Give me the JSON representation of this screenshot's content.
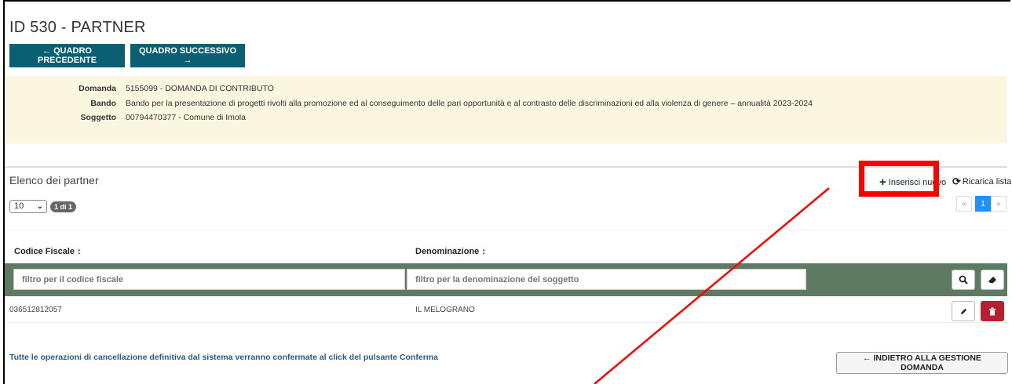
{
  "page": {
    "title": "ID 530 - PARTNER",
    "prev_label": "← QUADRO PRECEDENTE",
    "next_label": "QUADRO SUCCESSIVO →"
  },
  "info": {
    "rows": [
      {
        "label": "Domanda",
        "value": "5155099 - DOMANDA DI CONTRIBUTO"
      },
      {
        "label": "Bando",
        "value": "Bando per la presentazione di progetti rivolti alla promozione ed al conseguimento delle pari opportunità e al contrasto delle discriminazioni ed alla violenza di genere – annualità 2023-2024"
      },
      {
        "label": "Soggetto",
        "value": "00794470377 - Comune di Imola"
      }
    ]
  },
  "list": {
    "title": "Elenco dei partner",
    "page_size": "10",
    "page_badge": "1 di 1",
    "insert_label": "Inserisci nuovo",
    "reload_label": "Ricarica lista",
    "pager": [
      "«",
      "1",
      "»"
    ]
  },
  "table": {
    "columns": [
      "Codice Fiscale ↕",
      "Denominazione ↕"
    ],
    "filters": {
      "codice_placeholder": "filtro per il codice fiscale",
      "denominazione_placeholder": "filtro per la denominazione del soggetto"
    },
    "rows": [
      {
        "codice_fiscale": "036512812057",
        "denominazione": "IL MELOGRANO"
      }
    ]
  },
  "footer": {
    "note": "Tutte le operazioni di cancellazione definitiva dal sistema verranno confermate al click del pulsante Conferma",
    "back_label": "← INDIETRO ALLA GESTIONE DOMANDA"
  },
  "colors": {
    "primary": "#0a5f73",
    "info_bg": "#faf6e0",
    "filter_bar": "#5f7a63",
    "danger": "#b7202e",
    "annotation": "#ff0000"
  },
  "icons": [
    "plus-icon",
    "refresh-icon",
    "search-icon",
    "eraser-icon",
    "pencil-icon",
    "trash-icon",
    "sort-icon",
    "chevron-down-icon"
  ]
}
